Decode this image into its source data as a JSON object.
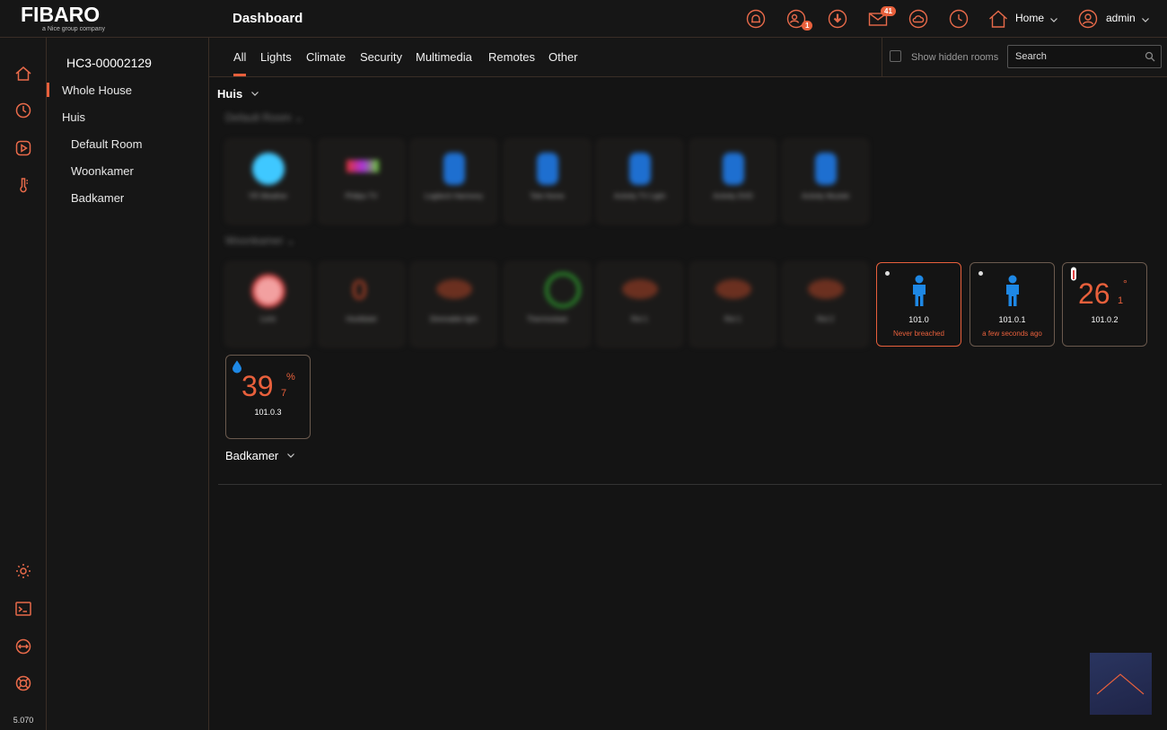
{
  "brand": {
    "name": "FIBARO",
    "tagline": "a Nice group company"
  },
  "version": "5.070",
  "rail": {
    "icons": [
      "home-icon",
      "scenes-icon",
      "play-icon",
      "thermometer-icon",
      "gear-icon",
      "terminal-icon",
      "network-icon",
      "help-icon"
    ]
  },
  "rooms_sidebar": {
    "controller": "HC3-00002129",
    "items": [
      {
        "label": "Whole House",
        "active": true
      },
      {
        "label": "Huis"
      },
      {
        "label": "Default Room"
      },
      {
        "label": "Woonkamer"
      },
      {
        "label": "Badkamer"
      }
    ]
  },
  "header": {
    "title": "Dashboard",
    "users_badge": "1",
    "messages_badge": "41",
    "location": "Home",
    "user": "admin"
  },
  "tabs": {
    "items": [
      "All",
      "Lights",
      "Climate",
      "Security",
      "Multimedia",
      "Remotes",
      "Other"
    ],
    "active": "All",
    "show_hidden_label": "Show hidden rooms",
    "search_placeholder": "Search"
  },
  "sections": {
    "huis": "Huis",
    "default_room": "Default Room",
    "woonkamer": "Woonkamer",
    "badkamer": "Badkamer"
  },
  "blurred_tiles_row1": [
    "YR Weather",
    "Philips TV",
    "Logitech Harmony",
    "Tele Home",
    "Activity TV Light",
    "Activity DVD",
    "Activity Muziek"
  ],
  "blurred_tiles_row2": [
    "Licht",
    "Hoofdstel",
    "Dimmable light",
    "Thermostaat",
    "Rol 1",
    "Rol 1",
    "Rol 2"
  ],
  "devices": {
    "motion1": {
      "name": "101.0",
      "status": "Never breached"
    },
    "motion2": {
      "name": "101.0.1",
      "status": "a few seconds ago"
    },
    "temperature": {
      "name": "101.0.2",
      "value": "26",
      "decimal": "1",
      "unit": "°"
    },
    "humidity": {
      "name": "101.0.3",
      "value": "39",
      "decimal": "7",
      "unit": "%"
    }
  },
  "colors": {
    "accent": "#e8603c",
    "background": "#141414",
    "person_icon": "#1e88e5"
  }
}
